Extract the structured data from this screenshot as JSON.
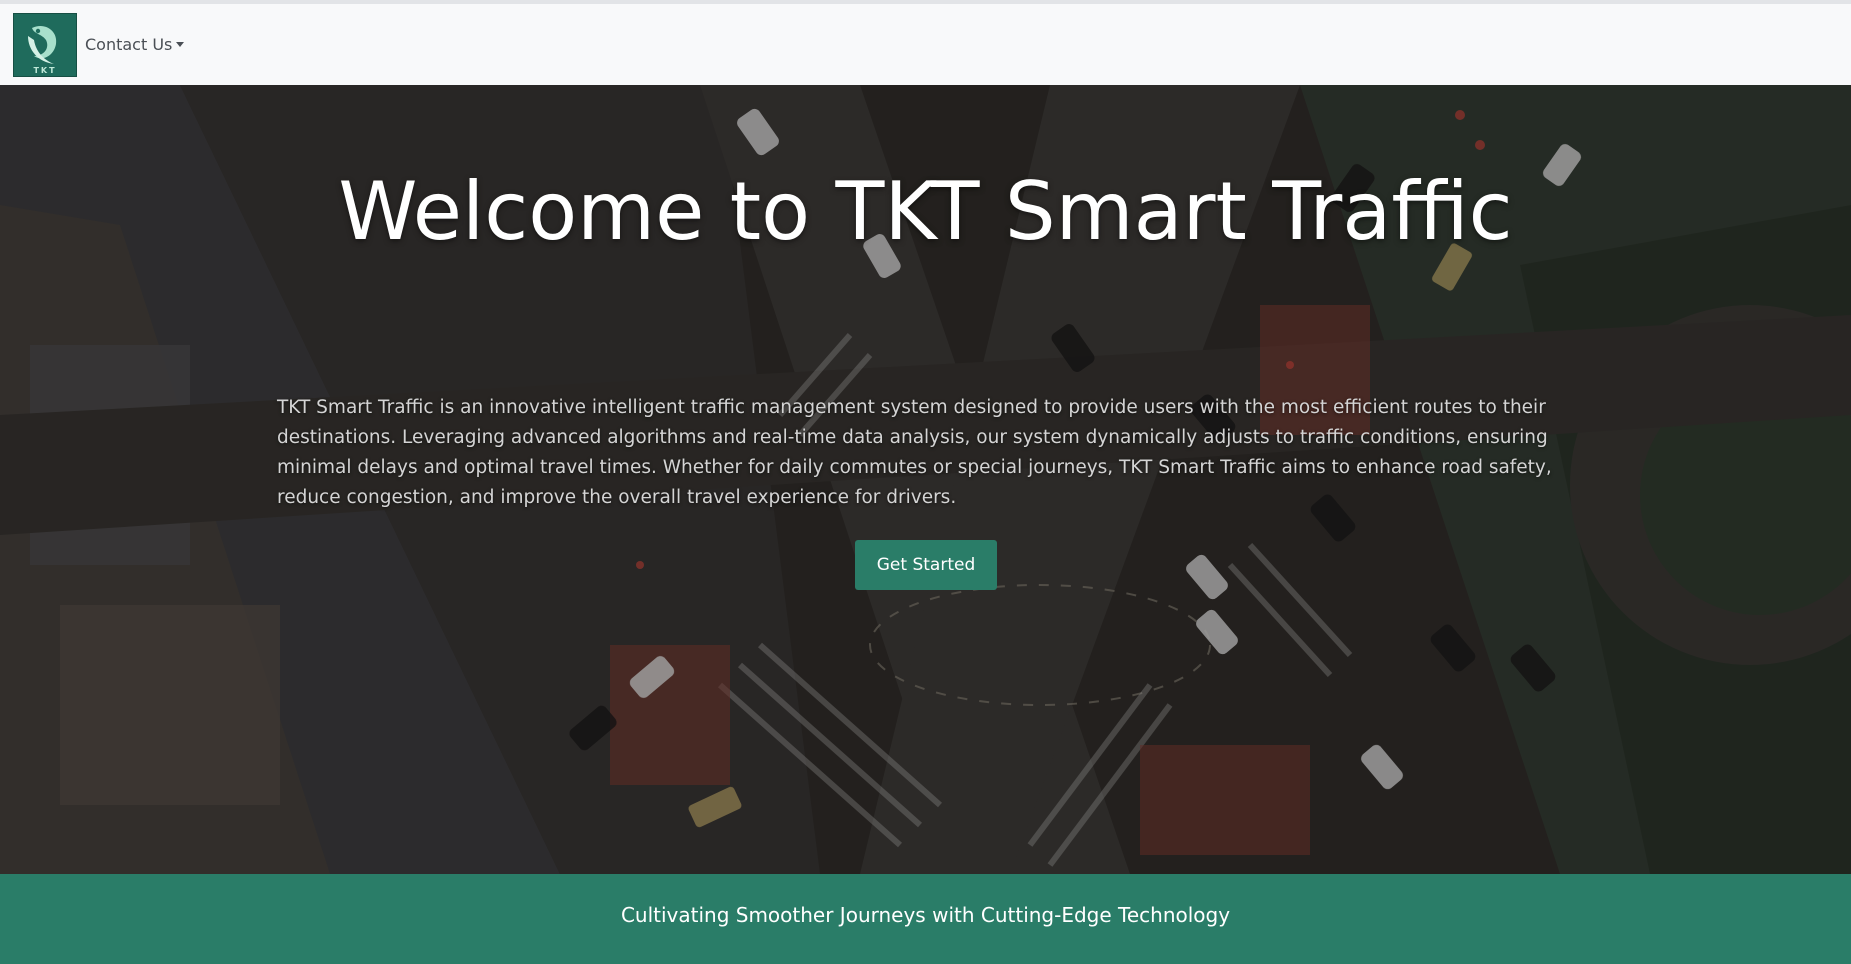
{
  "navbar": {
    "logo_text": "TKT",
    "contact_label": "Contact Us"
  },
  "hero": {
    "title": "Welcome to TKT Smart Traffic",
    "description": "TKT Smart Traffic is an innovative intelligent traffic management system designed to provide users with the most efficient routes to their destinations. Leveraging advanced algorithms and real-time data analysis, our system dynamically adjusts to traffic conditions, ensuring minimal delays and optimal travel times. Whether for daily commutes or special journeys, TKT Smart Traffic aims to enhance road safety, reduce congestion, and improve the overall travel experience for drivers.",
    "cta_label": "Get Started",
    "background_image": "aerial-night-intersection"
  },
  "footer": {
    "tagline": "Cultivating Smoother Journeys with Cutting-Edge Technology"
  },
  "colors": {
    "brand_green": "#2a7d68",
    "navbar_bg": "#f8f9fa",
    "logo_bg": "#1f6b5c"
  }
}
